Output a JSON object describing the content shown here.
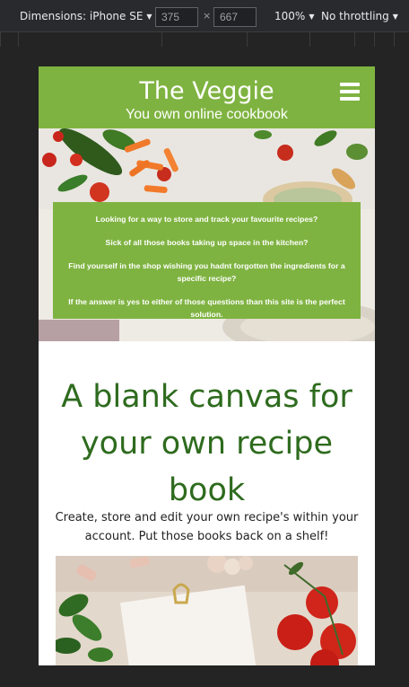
{
  "devtools": {
    "dimensions_label": "Dimensions: iPhone SE",
    "width_value": "375",
    "height_value": "667",
    "times": "×",
    "zoom": "100%",
    "throttling": "No throttling",
    "caret": "▼"
  },
  "header": {
    "title": "The Veggie",
    "subtitle": "You own online cookbook"
  },
  "intro": {
    "lines": [
      "Looking for a way to store and track your favourite recipes?",
      "Sick of all those books taking up space in the kitchen?",
      "Find yourself in the shop wishing you hadnt forgotten the ingredients for a specific recipe?",
      "If the answer is yes to either of those questions than this site is the perfect solution."
    ]
  },
  "main": {
    "headline": "A blank canvas for your own recipe book",
    "lead": "Create, store and edit your own recipe's within your account. Put those books back on a shelf!"
  },
  "colors": {
    "brand_green": "#7fb341",
    "headline_green": "#2e6b1e"
  },
  "icons": {
    "menu": "hamburger-menu-icon"
  }
}
